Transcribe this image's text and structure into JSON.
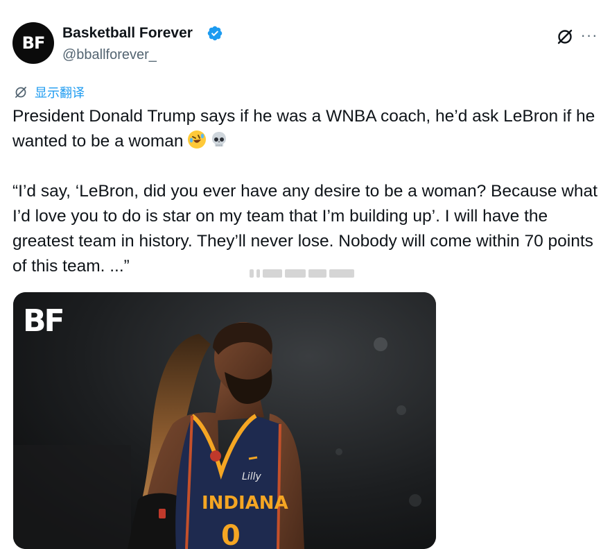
{
  "account": {
    "name": "Basketball Forever",
    "handle": "@bballforever_",
    "avatar_text": "BF",
    "verified": true
  },
  "actions": {
    "grok_icon": "grok-icon",
    "more_label": "···"
  },
  "translate_label": "显示翻译",
  "post": {
    "line1": "President Donald Trump says if he was a WNBA coach, he’d ask LeBron if he wanted to be a woman",
    "quote": "“I’d say, ‘LeBron, did you ever have any desire to be a woman? Because what I’d love you to do is star on my team that I’m building up’. I will have the greatest team in history. They’ll never lose. Nobody will come within 70 points of this team. ...”"
  },
  "media": {
    "logo_text": "BF",
    "jersey_text": "INDIANA",
    "jersey_number": "0",
    "sponsor_text": "Lilly",
    "colors": {
      "jersey": "#1e2a4f",
      "jersey_trim": "#f5a623"
    }
  },
  "colors": {
    "link": "#1d9bf0",
    "secondary": "#536471",
    "text": "#0f1419"
  }
}
